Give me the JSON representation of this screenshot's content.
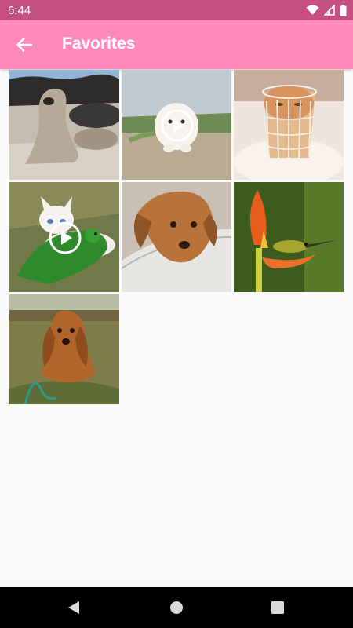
{
  "status_bar": {
    "time": "6:44",
    "icons": [
      "wifi-icon",
      "signal-icon",
      "battery-icon"
    ]
  },
  "app_bar": {
    "title": "Favorites",
    "back_icon": "arrow-back-icon",
    "color": "#ff8aba"
  },
  "gallery": {
    "items": [
      {
        "subject": "seal-on-rocks",
        "type": "image"
      },
      {
        "subject": "white-puppy-running",
        "type": "video"
      },
      {
        "subject": "cat-in-basket",
        "type": "image"
      },
      {
        "subject": "kitten-with-parrot",
        "type": "video"
      },
      {
        "subject": "dog-on-lap",
        "type": "image"
      },
      {
        "subject": "bird-on-flower",
        "type": "image"
      },
      {
        "subject": "long-haired-dog-on-grass",
        "type": "image"
      }
    ]
  },
  "nav_bar": {
    "buttons": [
      "back-triangle-icon",
      "home-circle-icon",
      "recents-square-icon"
    ]
  }
}
